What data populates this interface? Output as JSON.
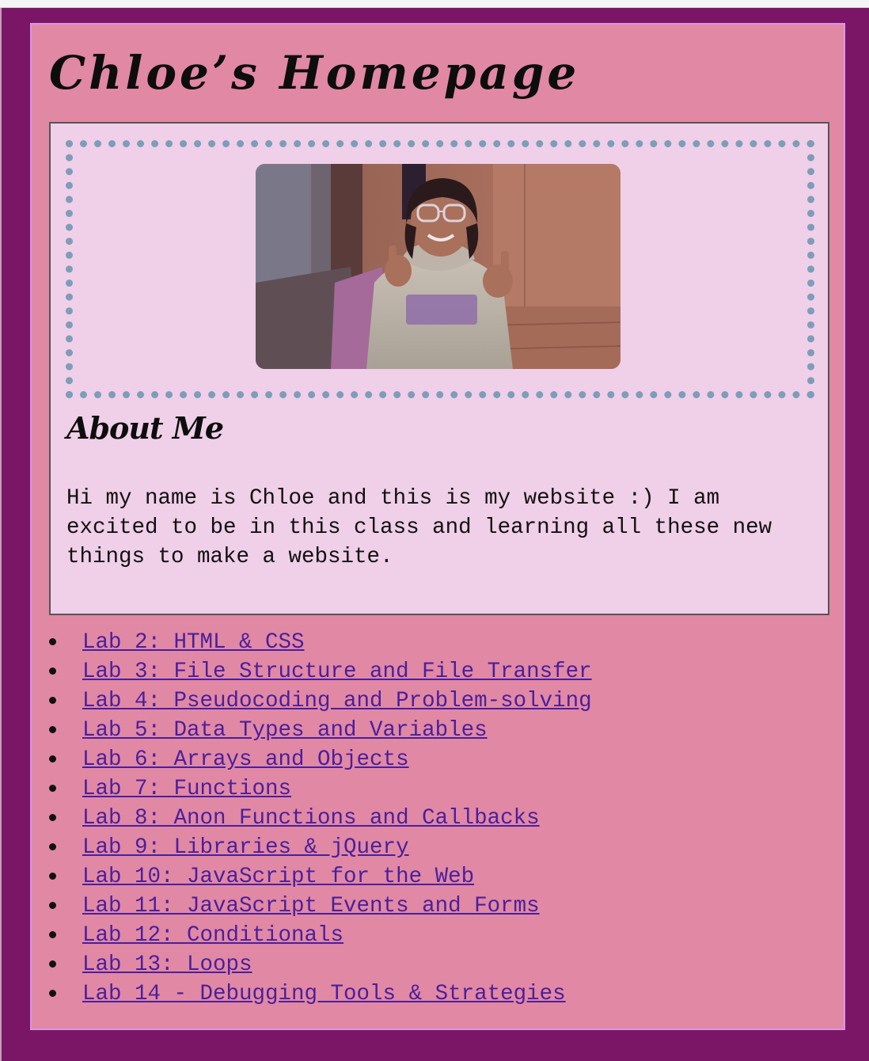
{
  "header": {
    "title": "Chloe’s Homepage"
  },
  "about": {
    "heading": "About Me",
    "text": "Hi my name is Chloe and this is my website :) I am excited to be in this class and learning all these new things to make a website."
  },
  "labs": [
    "Lab 2: HTML & CSS",
    "Lab 3: File Structure and File Transfer",
    "Lab 4: Pseudocoding and Problem-solving",
    "Lab 5: Data Types and Variables",
    "Lab 6: Arrays and Objects",
    "Lab 7: Functions",
    "Lab 8: Anon Functions and Callbacks",
    "Lab 9: Libraries & jQuery",
    "Lab 10: JavaScript for the Web",
    "Lab 11: JavaScript Events and Forms",
    "Lab 12: Conditionals",
    "Lab 13: Loops",
    "Lab 14 - Debugging Tools & Strategies"
  ],
  "colors": {
    "outer_frame": "#7b1666",
    "page_background": "#e188a5",
    "page_border": "#d795e6",
    "card_background": "#f0cfe9",
    "photo_border_dots": "#7d9db8",
    "link": "#4a1f9a"
  }
}
